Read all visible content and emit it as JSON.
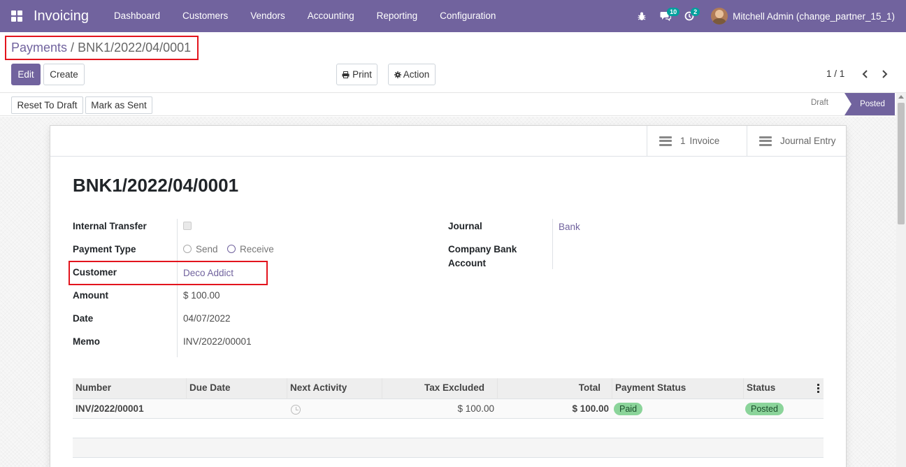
{
  "app": {
    "name": "Invoicing"
  },
  "menu": [
    "Dashboard",
    "Customers",
    "Vendors",
    "Accounting",
    "Reporting",
    "Configuration"
  ],
  "systray": {
    "messages_count": "10",
    "activities_count": "2",
    "user_name": "Mitchell Admin (change_partner_15_1)"
  },
  "breadcrumb": {
    "parent": "Payments",
    "separator": "/",
    "current": "BNK1/2022/04/0001"
  },
  "buttons": {
    "edit": "Edit",
    "create": "Create",
    "print": "Print",
    "action": "Action"
  },
  "pager": {
    "value": "1 / 1"
  },
  "statusbar": {
    "reset_to_draft": "Reset To Draft",
    "mark_as_sent": "Mark as Sent",
    "stages": [
      "Draft",
      "Posted"
    ],
    "active_stage": "Posted"
  },
  "smart_buttons": {
    "invoice_count": "1",
    "invoice_label": "Invoice",
    "journal_entry": "Journal Entry"
  },
  "record": {
    "title": "BNK1/2022/04/0001",
    "internal_transfer_label": "Internal Transfer",
    "payment_type_label": "Payment Type",
    "payment_type_options": [
      "Send",
      "Receive"
    ],
    "payment_type_selected": "Receive",
    "customer_label": "Customer",
    "customer_value": "Deco Addict",
    "amount_label": "Amount",
    "amount_value": "$ 100.00",
    "date_label": "Date",
    "date_value": "04/07/2022",
    "memo_label": "Memo",
    "memo_value": "INV/2022/00001",
    "journal_label": "Journal",
    "journal_value": "Bank",
    "company_bank_label_1": "Company Bank",
    "company_bank_label_2": "Account"
  },
  "table": {
    "headers": [
      "Number",
      "Due Date",
      "Next Activity",
      "Tax Excluded",
      "Total",
      "Payment Status",
      "Status"
    ],
    "rows": [
      {
        "number": "INV/2022/00001",
        "due_date": "",
        "tax_excluded": "$ 100.00",
        "total": "$ 100.00",
        "payment_status": "Paid",
        "status": "Posted"
      }
    ]
  },
  "colors": {
    "brand": "#71639e",
    "highlight": "#e3141d",
    "badge": "#00a09d",
    "pill": "#8bd49a"
  }
}
